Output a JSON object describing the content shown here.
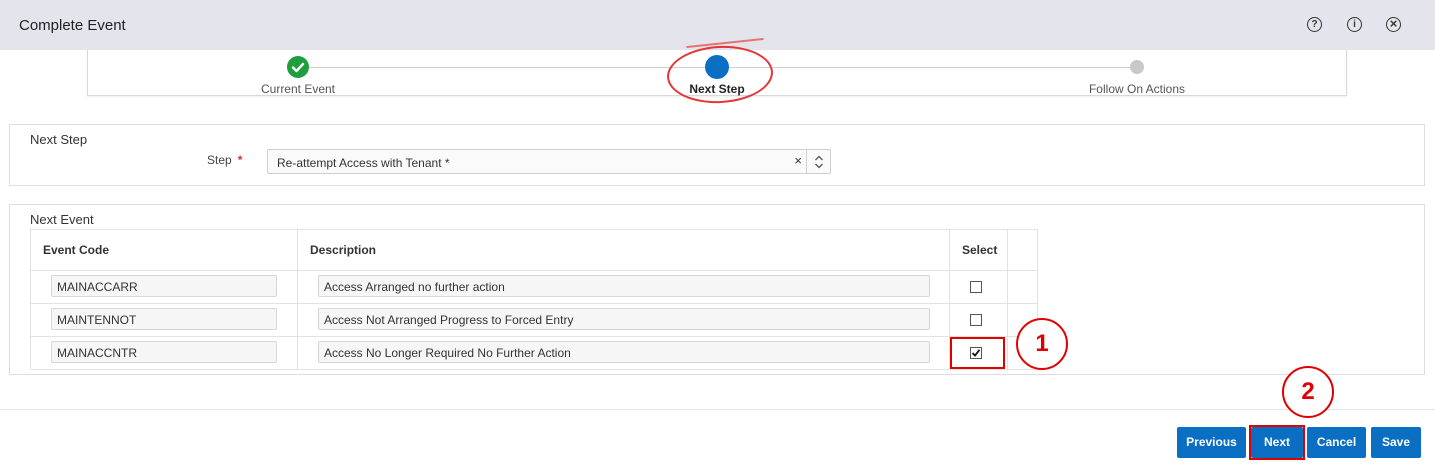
{
  "header": {
    "title": "Complete Event",
    "help_glyph": "?",
    "info_glyph": "i",
    "close_glyph": "×"
  },
  "train": {
    "stops": [
      {
        "label": "Current Event",
        "state": "completed"
      },
      {
        "label": "Next Step",
        "state": "current"
      },
      {
        "label": "Follow On Actions",
        "state": "pending"
      }
    ],
    "colors": {
      "completed": "#1e9e3e",
      "current": "#0a6fc2",
      "pending": "#c8c8c8"
    }
  },
  "next_step": {
    "title": "Next Step",
    "step_label": "Step",
    "required_marker": "*",
    "step_value": "Re-attempt Access with Tenant *",
    "clear_glyph": "×"
  },
  "next_event": {
    "title": "Next Event",
    "columns": [
      "Event Code",
      "Description",
      "Select"
    ],
    "rows": [
      {
        "code": "MAINACCARR",
        "description": "Access Arranged no further action",
        "selected": false
      },
      {
        "code": "MAINTENNOT",
        "description": "Access Not Arranged Progress to Forced Entry",
        "selected": false
      },
      {
        "code": "MAINACCNTR",
        "description": "Access No Longer Required No Further Action",
        "selected": true
      }
    ]
  },
  "annotations": {
    "one": "1",
    "two": "2",
    "color": "#e00000"
  },
  "buttons": {
    "previous": "Previous",
    "next": "Next",
    "cancel": "Cancel",
    "save": "Save",
    "color": "#0a6fc2"
  }
}
